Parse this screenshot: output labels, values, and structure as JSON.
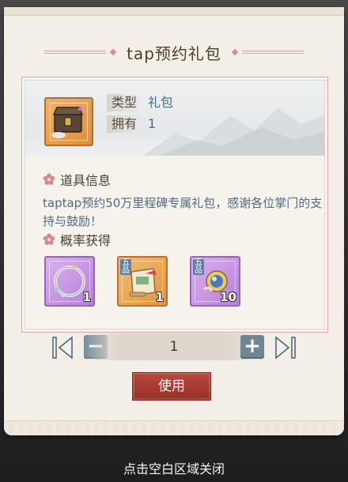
{
  "dialog": {
    "title": "tap预约礼包"
  },
  "item": {
    "icon": "treasure-chest-icon",
    "type_label": "类型",
    "type_value": "礼包",
    "owned_label": "拥有",
    "owned_value": "1"
  },
  "description": {
    "heading": "道具信息",
    "text": "taptap预约50万里程碑专属礼包，感谢各位掌门的支持与鼓励！"
  },
  "rewards": {
    "heading": "概率获得",
    "items": [
      {
        "icon": "bracelet-icon",
        "count": "1",
        "rarity": "purple"
      },
      {
        "icon": "scroll-icon",
        "count": "1",
        "rarity": "orange",
        "grade": "五品"
      },
      {
        "icon": "pearl-icon",
        "count": "10",
        "rarity": "purple",
        "grade": "五品"
      }
    ]
  },
  "quantity": {
    "value": "1",
    "minus_label": "−",
    "plus_label": "+"
  },
  "actions": {
    "use_label": "使用"
  },
  "footer": {
    "close_hint": "点击空白区域关闭"
  },
  "colors": {
    "accent_red": "#a63a2f",
    "stepper_blue": "#6e8696",
    "text_blue": "#4f6a85"
  }
}
